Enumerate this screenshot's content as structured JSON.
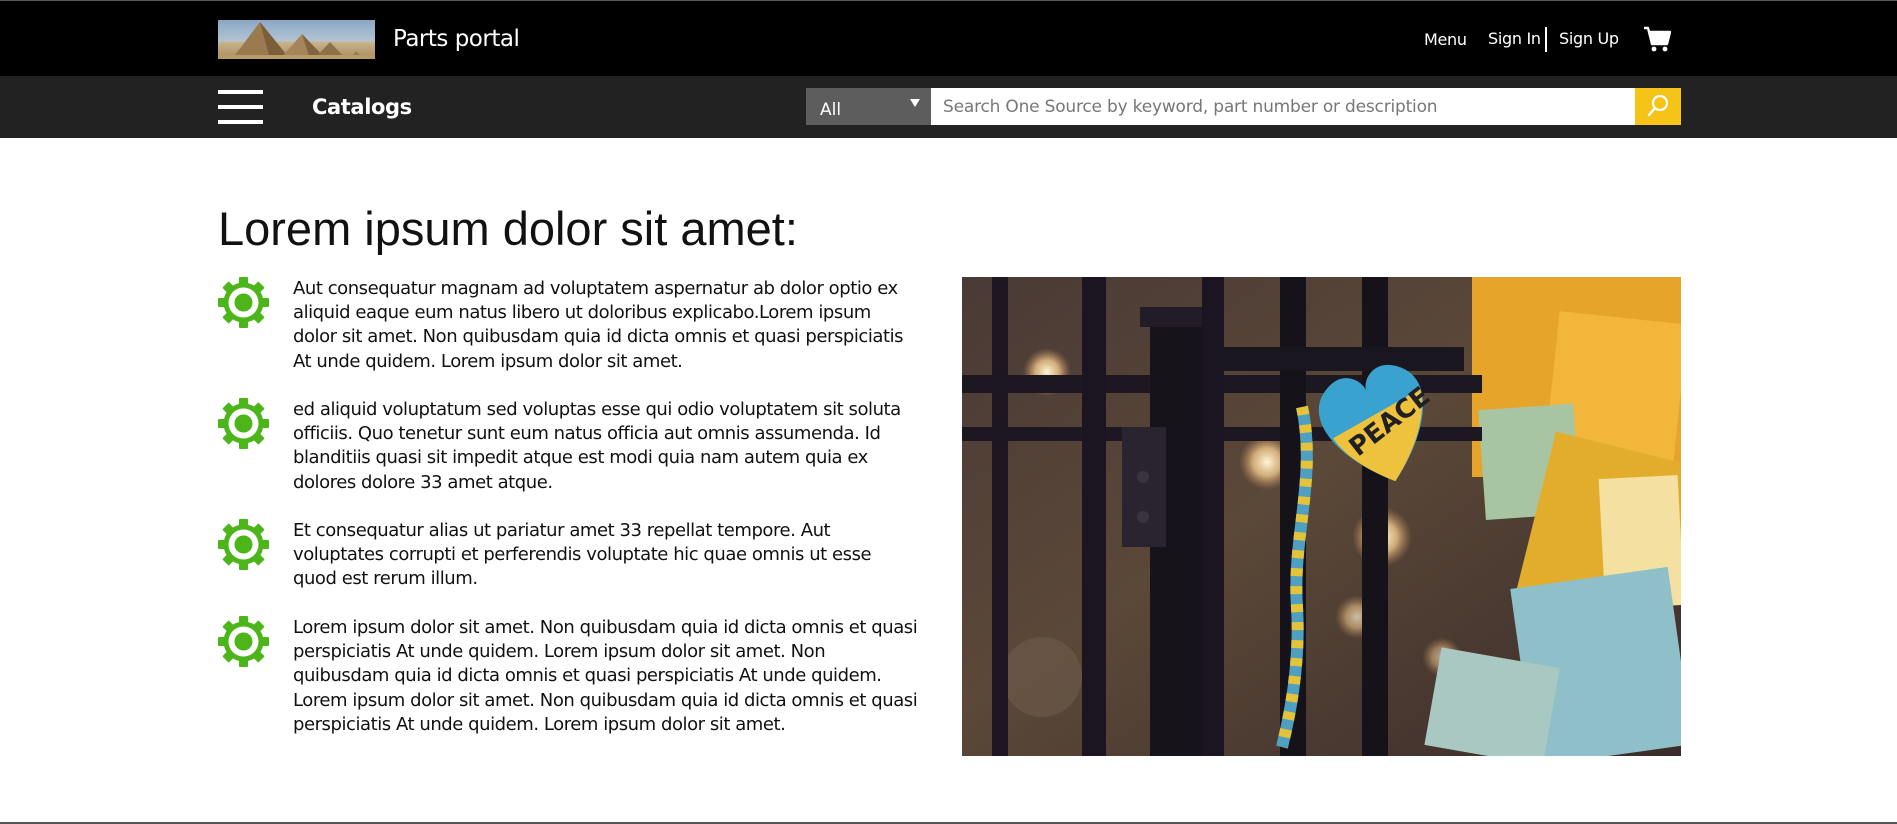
{
  "header": {
    "site_name": "Parts portal",
    "nav": {
      "menu": "Menu",
      "sign_in": "Sign In",
      "sign_up": "Sign Up"
    },
    "cart_icon": "shopping-cart-icon"
  },
  "subbar": {
    "menu_icon": "hamburger-icon",
    "catalogs": "Catalogs",
    "search": {
      "scope_value": "All",
      "placeholder": "Search One Source by keyword, part number or description",
      "value": "",
      "button_icon": "search-icon"
    }
  },
  "main": {
    "heading": "Lorem ipsum dolor sit amet:",
    "feature_icon": "gear-icon",
    "features": [
      "Aut consequatur magnam ad voluptatem aspernatur ab dolor optio ex aliquid eaque eum natus libero ut doloribus explicabo.Lorem ipsum dolor sit amet. Non quibusdam quia id dicta omnis et quasi perspiciatis At unde quidem. Lorem ipsum dolor sit amet.",
      "ed aliquid voluptatum sed voluptas esse qui odio voluptatem sit soluta officiis. Quo tenetur sunt eum natus officia aut omnis assumenda. Id blanditiis quasi sit impedit atque est modi quia nam autem quia ex dolores dolore 33 amet atque.",
      "Et consequatur alias ut pariatur amet 33 repellat tempore. Aut voluptates corrupti et perferendis voluptate hic quae omnis ut esse quod est rerum illum.",
      "Lorem ipsum dolor sit amet. Non quibusdam quia id dicta omnis et quasi perspiciatis At unde quidem. Lorem ipsum dolor sit amet. Non quibusdam quia id dicta omnis et quasi perspiciatis At unde quidem. Lorem ipsum dolor sit amet. Non quibusdam quia id dicta omnis et quasi perspiciatis At unde quidem. Lorem ipsum dolor sit amet."
    ],
    "photo_text": "PEACE"
  },
  "colors": {
    "topbar": "#000000",
    "subbar": "#222222",
    "accent_yellow": "#f6c417",
    "gear_green": "#4cb51a",
    "scope_gray": "#5d5d5d"
  }
}
